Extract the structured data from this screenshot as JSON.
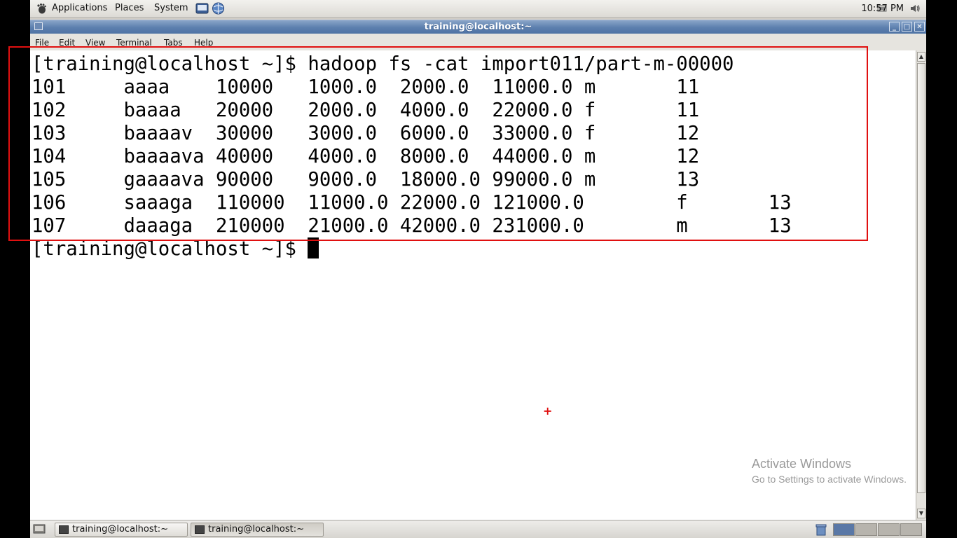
{
  "top_panel": {
    "menus": [
      "Applications",
      "Places",
      "System"
    ],
    "clock": "10:57 PM",
    "icons": [
      "gnome-foot-icon",
      "terminal-launcher-icon",
      "web-browser-icon",
      "network-icon",
      "volume-icon"
    ]
  },
  "window": {
    "title": "training@localhost:~",
    "menu": [
      "File",
      "Edit",
      "View",
      "Terminal",
      "Tabs",
      "Help"
    ]
  },
  "terminal": {
    "lines": [
      "[training@localhost ~]$ hadoop fs -cat import011/part-m-00000",
      "101     aaaa    10000   1000.0  2000.0  11000.0 m       11",
      "102     baaaa   20000   2000.0  4000.0  22000.0 f       11",
      "103     baaaav  30000   3000.0  6000.0  33000.0 f       12",
      "104     baaaava 40000   4000.0  8000.0  44000.0 m       12",
      "105     gaaaava 90000   9000.0  18000.0 99000.0 m       13",
      "106     saaaga  110000  11000.0 22000.0 121000.0        f       13",
      "107     daaaga  210000  21000.0 42000.0 231000.0        m       13"
    ],
    "prompt": "[training@localhost ~]$ "
  },
  "taskbar": {
    "items": [
      {
        "label": "training@localhost:~",
        "active": false
      },
      {
        "label": "training@localhost:~",
        "active": true
      }
    ]
  },
  "overlay": {
    "activate_title": "Activate Windows",
    "activate_subtitle": "Go to Settings to activate Windows.",
    "highlight_color": "#e01010"
  }
}
